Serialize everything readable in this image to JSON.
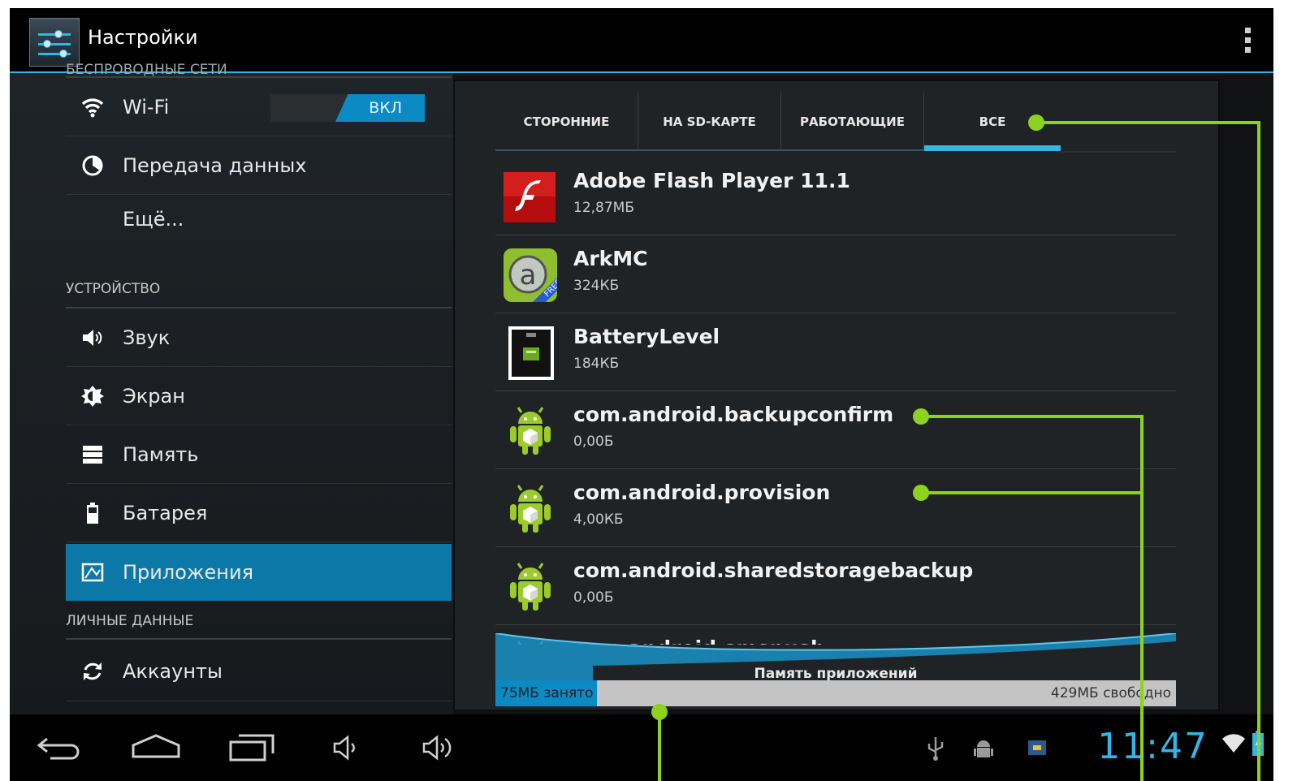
{
  "actionbar": {
    "title": "Настройки"
  },
  "left": {
    "cut_section": "БЕСПРОВОДНЫЕ СЕТИ",
    "wifi": {
      "label": "Wi-Fi",
      "toggle": "ВКЛ"
    },
    "data_usage": "Передача данных",
    "more": "Ещё...",
    "device_section": "УСТРОЙСТВО",
    "sound": "Звук",
    "display": "Экран",
    "storage": "Память",
    "battery": "Батарея",
    "apps": "Приложения",
    "personal_section": "ЛИЧНЫЕ ДАННЫЕ",
    "accounts": "Аккаунты"
  },
  "tabs": [
    "СТОРОННИЕ",
    "НА SD-КАРТЕ",
    "РАБОТАЮЩИЕ",
    "ВСЕ"
  ],
  "selected_tab": "ВСЕ",
  "apps": [
    {
      "name": "Adobe Flash Player 11.1",
      "size": "12,87МБ",
      "icon": "flash-icon"
    },
    {
      "name": "ArkMC",
      "size": "324КБ",
      "icon": "arkmc-icon"
    },
    {
      "name": "BatteryLevel",
      "size": "184КБ",
      "icon": "battery-level-icon"
    },
    {
      "name": "com.android.backupconfirm",
      "size": "0,00Б",
      "icon": "android-icon"
    },
    {
      "name": "com.android.provision",
      "size": "4,00КБ",
      "icon": "android-icon"
    },
    {
      "name": "com.android.sharedstoragebackup",
      "size": "0,00Б",
      "icon": "android-icon"
    },
    {
      "name": "com.android.smspush",
      "size": "",
      "icon": "android-icon"
    }
  ],
  "storage": {
    "label": "Память приложений",
    "used": "75МБ занято",
    "free": "429МБ свободно",
    "used_fraction": 0.149
  },
  "clock": "11:47",
  "colors": {
    "accent": "#33b5e5",
    "selected": "#0b78a7",
    "callout": "#8cd21e"
  }
}
